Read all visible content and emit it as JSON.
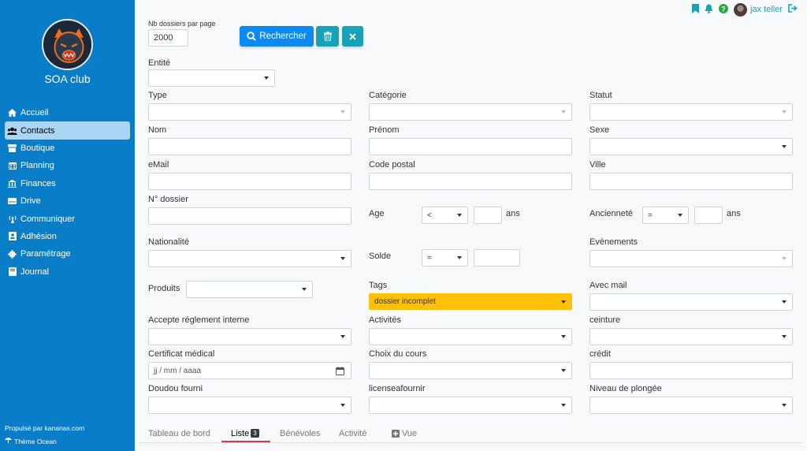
{
  "app": {
    "club_name": "SOA club",
    "powered_by": "Propulsé par kananas.com",
    "theme": "Thème Ocean"
  },
  "sidebar": {
    "items": [
      {
        "label": "Accueil",
        "icon": "home-icon"
      },
      {
        "label": "Contacts",
        "icon": "users-icon",
        "active": true
      },
      {
        "label": "Boutique",
        "icon": "store-icon"
      },
      {
        "label": "Planning",
        "icon": "calendar-icon"
      },
      {
        "label": "Finances",
        "icon": "bank-icon"
      },
      {
        "label": "Drive",
        "icon": "drive-icon"
      },
      {
        "label": "Communiquer",
        "icon": "broadcast-icon"
      },
      {
        "label": "Adhésion",
        "icon": "id-card-icon"
      },
      {
        "label": "Paramétrage",
        "icon": "gear-icon"
      },
      {
        "label": "Journal",
        "icon": "book-icon"
      }
    ]
  },
  "topbar": {
    "user_name": "jax teller",
    "icons": [
      "bookmark-icon",
      "bell-icon",
      "help-icon",
      "logout-icon"
    ]
  },
  "toolbar": {
    "per_page_label": "Nb dossiers par page",
    "per_page_value": "2000",
    "search_label": "Rechercher"
  },
  "form": {
    "entite": "Entité",
    "type": "Type",
    "categorie": "Catégorie",
    "statut": "Statut",
    "nom": "Nom",
    "prenom": "Prénom",
    "sexe": "Sexe",
    "email": "eMail",
    "code_postal": "Code postal",
    "ville": "Ville",
    "no_dossier": "N° dossier",
    "age": "Age",
    "age_op": "<",
    "age_unit": "ans",
    "anciennete": "Ancienneté",
    "anciennete_op": "=",
    "anciennete_unit": "ans",
    "nationalite": "Nationalité",
    "solde": "Solde",
    "solde_op": "=",
    "evenements": "Evènements",
    "produits": "Produits",
    "tags": "Tags",
    "tags_value": "dossier incomplet",
    "avec_mail": "Avec mail",
    "accepte_reglement": "Accepte réglement interne",
    "activites": "Activités",
    "ceinture": "ceinture",
    "certificat": "Certificat médical",
    "certificat_placeholder": "jj / mm / aaaa",
    "choix_cours": "Choix du cours",
    "credit": "crédit",
    "doudou": "Doudou fourni",
    "licence": "licenseafournir",
    "plongee": "Niveau de plongée"
  },
  "tabs": [
    {
      "label": "Tableau de bord"
    },
    {
      "label": "Liste",
      "badge": "3",
      "active": true
    },
    {
      "label": "Bénévoles"
    },
    {
      "label": "Activité"
    },
    {
      "label": "Vue",
      "icon": "plus-square-icon"
    }
  ],
  "colors": {
    "sidebar": "#0a7dc8",
    "primary": "#0d8af2",
    "teal": "#17a2b8",
    "tag_yellow": "#ffc107",
    "tab_underline": "#dc3545"
  }
}
